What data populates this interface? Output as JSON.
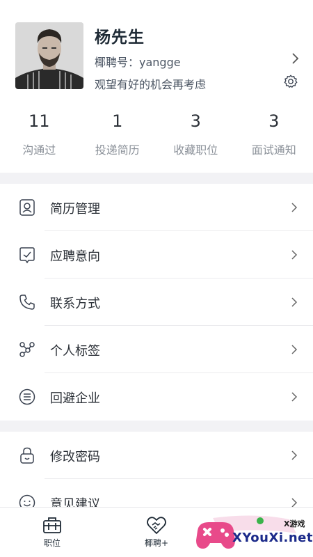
{
  "profile": {
    "name": "杨先生",
    "account": "椰聘号：yangge",
    "status": "观望有好的机会再考虑"
  },
  "stats": [
    {
      "value": "11",
      "label": "沟通过"
    },
    {
      "value": "1",
      "label": "投递简历"
    },
    {
      "value": "3",
      "label": "收藏职位"
    },
    {
      "value": "3",
      "label": "面试通知"
    }
  ],
  "menu": [
    {
      "label": "简历管理",
      "icon": "resume-icon"
    },
    {
      "label": "应聘意向",
      "icon": "intention-icon"
    },
    {
      "label": "联系方式",
      "icon": "phone-icon"
    },
    {
      "label": "个人标签",
      "icon": "tag-icon"
    },
    {
      "label": "回避企业",
      "icon": "block-list-icon"
    },
    {
      "label": "修改密码",
      "icon": "lock-icon"
    },
    {
      "label": "意见建议",
      "icon": "feedback-icon"
    }
  ],
  "tabs": [
    {
      "label": "职位",
      "icon": "briefcase-icon"
    },
    {
      "label": "椰聘+",
      "icon": "handshake-icon"
    }
  ],
  "watermark": {
    "small": "X游戏",
    "big": "XYouXi.net"
  },
  "colors": {
    "accent": "#1e2a35",
    "divider": "#f2f2f5",
    "watermark_pink": "#e84a8a",
    "watermark_blue": "#1b2a8a"
  }
}
